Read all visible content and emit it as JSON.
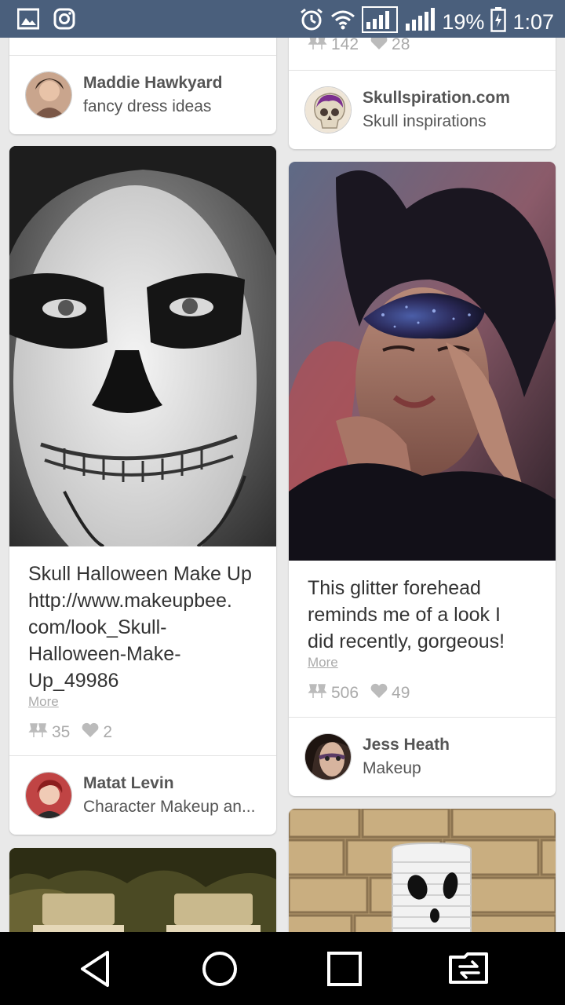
{
  "status_bar": {
    "battery": "19%",
    "time": "1:07",
    "icons": [
      "gallery-icon",
      "instagram-icon",
      "alarm-icon",
      "wifi-icon",
      "data-signal-icon",
      "cell-signal-icon",
      "battery-icon"
    ]
  },
  "feed": {
    "left_column": {
      "top_pinner": {
        "name": "Maddie Hawkyard",
        "board": "fancy dress ideas"
      },
      "skull_pin": {
        "description": "Skull Halloween Make Up http://www.makeupbee.com/look_Skull-Halloween-Make-Up_49986",
        "description_lines": [
          "Skull Halloween Make Up",
          "http://www.makeupbee.",
          "com/look_Skull-",
          "Halloween-Make-",
          "Up_49986"
        ],
        "more": "More",
        "repins": "35",
        "likes": "2",
        "pinner": {
          "name": "Matat Levin",
          "board": "Character Makeup an..."
        }
      }
    },
    "right_column": {
      "top_pin": {
        "repins": "142",
        "likes": "28",
        "pinner": {
          "name": "Skullspiration.com",
          "board": "Skull inspirations"
        }
      },
      "glitter_pin": {
        "description_lines": [
          "This glitter forehead",
          "reminds me of a look I",
          "did recently, gorgeous!"
        ],
        "more": "More",
        "repins": "506",
        "likes": "49",
        "pinner": {
          "name": "Jess Heath",
          "board": "Makeup"
        }
      }
    }
  },
  "nav_bar": {
    "icons": [
      "back-icon",
      "home-icon",
      "recents-icon",
      "switch-sim-icon"
    ]
  },
  "colors": {
    "status_bar": "#4a5f7c",
    "feed_background": "#e9e9e9",
    "card": "#ffffff",
    "text": "#333333",
    "muted": "#aaaaaa"
  }
}
